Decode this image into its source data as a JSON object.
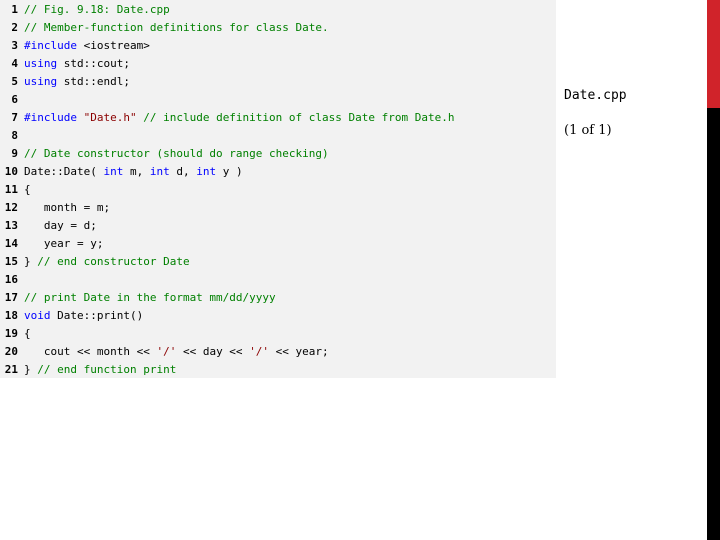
{
  "side": {
    "filename": "Date.cpp",
    "pager": "(1 of 1)"
  },
  "colors": {
    "comment": "#008000",
    "keyword": "#0000ff",
    "string": "#8b0000",
    "accent_bar_red": "#d0232a",
    "accent_bar_black": "#000000",
    "code_background": "#f2f2f2"
  },
  "code": {
    "lines": [
      {
        "num": "1",
        "tokens": [
          {
            "t": "c",
            "v": "// Fig. 9.18: Date.cpp"
          }
        ]
      },
      {
        "num": "2",
        "tokens": [
          {
            "t": "c",
            "v": "// Member-function definitions for class Date."
          }
        ]
      },
      {
        "num": "3",
        "tokens": [
          {
            "t": "k",
            "v": "#include"
          },
          {
            "t": "n",
            "v": " <iostream>"
          }
        ]
      },
      {
        "num": "4",
        "tokens": [
          {
            "t": "k",
            "v": "using"
          },
          {
            "t": "n",
            "v": " std::cout;"
          }
        ]
      },
      {
        "num": "5",
        "tokens": [
          {
            "t": "k",
            "v": "using"
          },
          {
            "t": "n",
            "v": " std::endl;"
          }
        ]
      },
      {
        "num": "6",
        "tokens": []
      },
      {
        "num": "7",
        "tokens": [
          {
            "t": "k",
            "v": "#include"
          },
          {
            "t": "n",
            "v": " "
          },
          {
            "t": "s",
            "v": "\"Date.h\""
          },
          {
            "t": "n",
            "v": " "
          },
          {
            "t": "c",
            "v": "// include definition of class Date from Date.h"
          }
        ]
      },
      {
        "num": "8",
        "tokens": []
      },
      {
        "num": "9",
        "tokens": [
          {
            "t": "c",
            "v": "// Date constructor (should do range checking)"
          }
        ]
      },
      {
        "num": "10",
        "tokens": [
          {
            "t": "n",
            "v": "Date::Date( "
          },
          {
            "t": "k",
            "v": "int"
          },
          {
            "t": "n",
            "v": " m, "
          },
          {
            "t": "k",
            "v": "int"
          },
          {
            "t": "n",
            "v": " d, "
          },
          {
            "t": "k",
            "v": "int"
          },
          {
            "t": "n",
            "v": " y )"
          }
        ]
      },
      {
        "num": "11",
        "tokens": [
          {
            "t": "n",
            "v": "{"
          }
        ]
      },
      {
        "num": "12",
        "tokens": [
          {
            "t": "n",
            "v": "   month = m;"
          }
        ]
      },
      {
        "num": "13",
        "tokens": [
          {
            "t": "n",
            "v": "   day = d;"
          }
        ]
      },
      {
        "num": "14",
        "tokens": [
          {
            "t": "n",
            "v": "   year = y;"
          }
        ]
      },
      {
        "num": "15",
        "tokens": [
          {
            "t": "n",
            "v": "} "
          },
          {
            "t": "c",
            "v": "// end constructor Date"
          }
        ]
      },
      {
        "num": "16",
        "tokens": []
      },
      {
        "num": "17",
        "tokens": [
          {
            "t": "c",
            "v": "// print Date in the format mm/dd/yyyy"
          }
        ]
      },
      {
        "num": "18",
        "tokens": [
          {
            "t": "k",
            "v": "void"
          },
          {
            "t": "n",
            "v": " Date::print()"
          }
        ]
      },
      {
        "num": "19",
        "tokens": [
          {
            "t": "n",
            "v": "{"
          }
        ]
      },
      {
        "num": "20",
        "tokens": [
          {
            "t": "n",
            "v": "   cout << month << "
          },
          {
            "t": "s",
            "v": "'/'"
          },
          {
            "t": "n",
            "v": " << day << "
          },
          {
            "t": "s",
            "v": "'/'"
          },
          {
            "t": "n",
            "v": " << year;"
          }
        ]
      },
      {
        "num": "21",
        "tokens": [
          {
            "t": "n",
            "v": "} "
          },
          {
            "t": "c",
            "v": "// end function print"
          }
        ]
      }
    ]
  }
}
